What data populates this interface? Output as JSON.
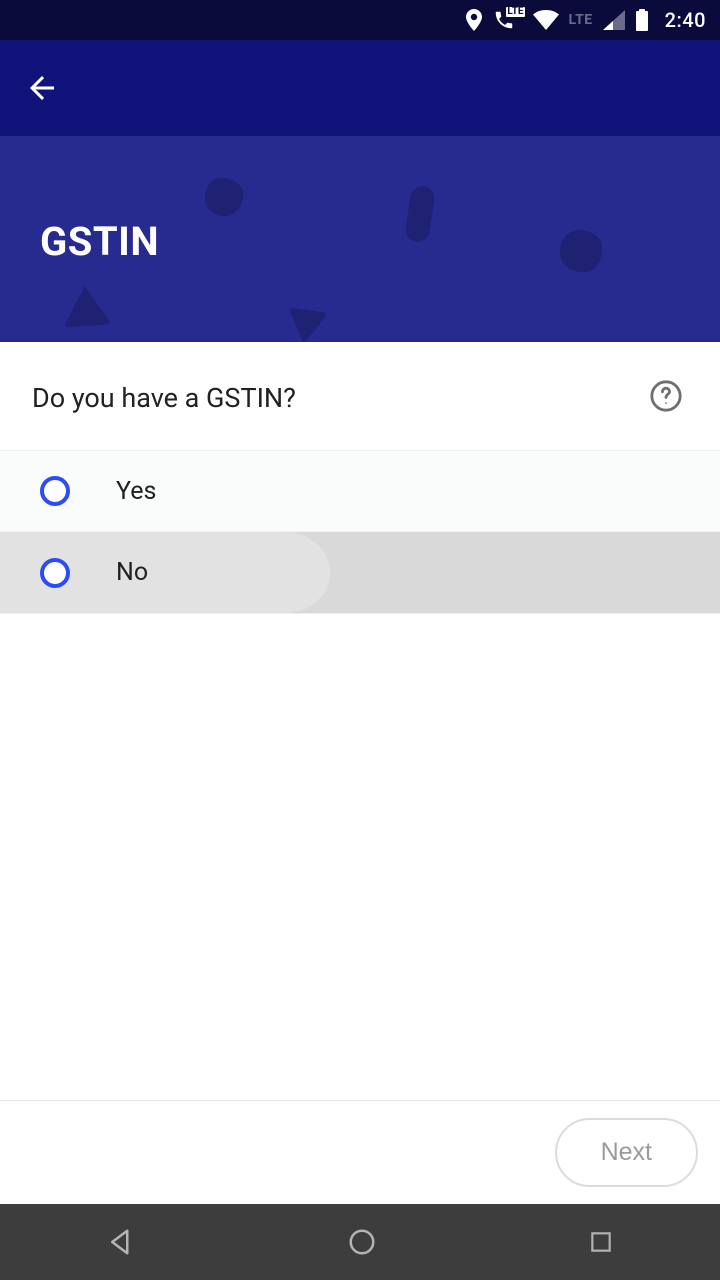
{
  "status": {
    "lte_label": "LTE",
    "time": "2:40"
  },
  "hero": {
    "title": "GSTIN"
  },
  "question": {
    "text": "Do you have a GSTIN?"
  },
  "options": {
    "yes": "Yes",
    "no": "No"
  },
  "footer": {
    "next_label": "Next"
  }
}
